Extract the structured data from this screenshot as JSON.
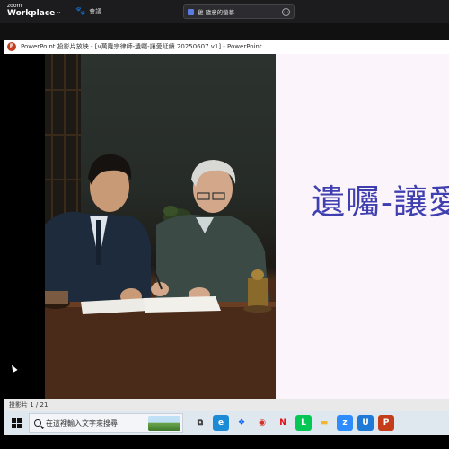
{
  "zoom": {
    "brand_top": "zoom",
    "brand_bottom": "Workplace",
    "meeting_label": "會議",
    "share_label": "雞 隨意的螢幕"
  },
  "powerpoint": {
    "window_title": "PowerPoint 投影片放映 - [v萬隆宗律師-遺囑-讓愛延續 20250607 v1] - PowerPoint",
    "slide_title": "遺囑-讓愛",
    "status": "投影片 1 / 21"
  },
  "taskbar": {
    "search_placeholder": "在這裡輸入文字來搜尋",
    "apps": [
      {
        "name": "task-view-icon",
        "glyph": "⧉",
        "color": "#333333",
        "bg": "transparent"
      },
      {
        "name": "edge-icon",
        "glyph": "e",
        "color": "#ffffff",
        "bg": "#1b8bd6"
      },
      {
        "name": "dropbox-icon",
        "glyph": "❖",
        "color": "#0061fe",
        "bg": "transparent"
      },
      {
        "name": "chrome-icon",
        "glyph": "◉",
        "color": "#d93025",
        "bg": "transparent"
      },
      {
        "name": "netflix-icon",
        "glyph": "N",
        "color": "#e50914",
        "bg": "transparent"
      },
      {
        "name": "line-icon",
        "glyph": "L",
        "color": "#ffffff",
        "bg": "#06c755"
      },
      {
        "name": "file-explorer-icon",
        "glyph": "▬",
        "color": "#f2b632",
        "bg": "transparent"
      },
      {
        "name": "zoom-icon",
        "glyph": "z",
        "color": "#ffffff",
        "bg": "#2d8cff"
      },
      {
        "name": "u-app-icon",
        "glyph": "U",
        "color": "#ffffff",
        "bg": "#1e7ad6"
      },
      {
        "name": "powerpoint-icon",
        "glyph": "P",
        "color": "#ffffff",
        "bg": "#c43e1c"
      }
    ]
  },
  "colors": {
    "slide_title": "#3f3fb0",
    "slide_bg": "#fbf4fb",
    "powerpoint_accent": "#c43e1c"
  }
}
